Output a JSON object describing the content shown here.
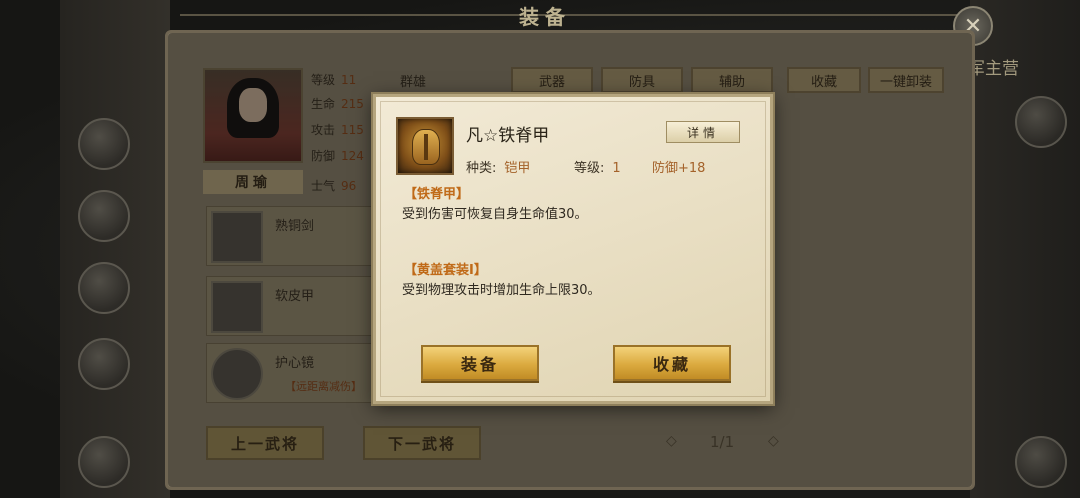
{
  "header": {
    "title": "装备",
    "right_title": "军主营",
    "close_icon": "close-x-icon"
  },
  "character": {
    "name": "周瑜",
    "faction": "群雄",
    "stats": [
      {
        "label": "等级",
        "value": "11"
      },
      {
        "label": "生命",
        "value": "215"
      },
      {
        "label": "攻击",
        "value": "115"
      },
      {
        "label": "防御",
        "value": "124"
      },
      {
        "label": "士气",
        "value": "96"
      }
    ]
  },
  "tabs": [
    {
      "label": "武器"
    },
    {
      "label": "防具"
    },
    {
      "label": "辅助"
    }
  ],
  "top_actions": {
    "collect": "收藏",
    "unequip_all": "一键卸装"
  },
  "equipment_slots": [
    {
      "name": "熟铜剑",
      "sub": "",
      "icon": "sword-icon"
    },
    {
      "name": "软皮甲",
      "sub": "",
      "icon": "armor-icon"
    },
    {
      "name": "护心镜",
      "sub": "【远距离减伤】",
      "icon": "mirror-icon"
    }
  ],
  "navigation": {
    "prev": "上一武将",
    "next": "下一武将",
    "page": "1/1"
  },
  "modal": {
    "item_name": "凡☆铁脊甲",
    "detail_button": "详情",
    "type_label": "种类:",
    "type_value": "铠甲",
    "level_label": "等级:",
    "level_value": "1",
    "bonus": "防御+18",
    "effects": [
      {
        "title": "【铁脊甲】",
        "desc": "受到伤害可恢复自身生命值30。"
      },
      {
        "title": "【黄盖套装Ⅰ】",
        "desc": "受到物理攻击时增加生命上限30。"
      }
    ],
    "equip_button": "装备",
    "collect_button": "收藏"
  }
}
